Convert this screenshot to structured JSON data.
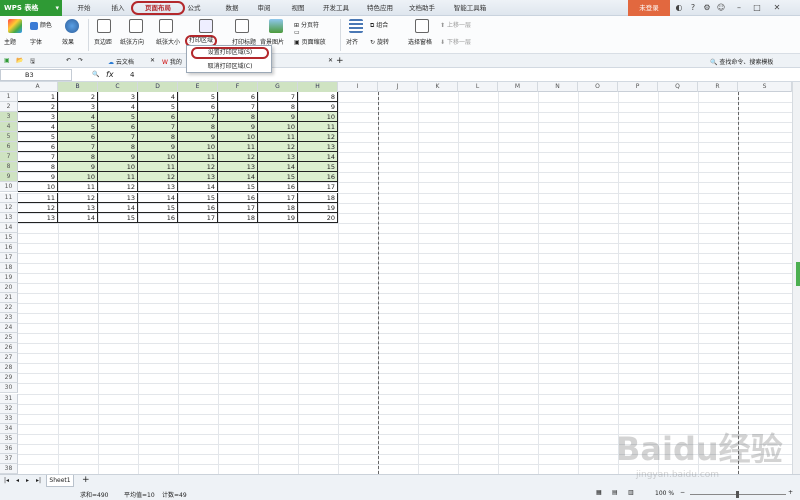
{
  "titlebar": {
    "app_name": "WPS 表格",
    "app_dd": "▾",
    "tabs": [
      "开始",
      "插入",
      "页面布局",
      "公式",
      "数据",
      "审阅",
      "视图",
      "开发工具",
      "特色应用",
      "文档助手",
      "智能工具箱"
    ],
    "login": "未登录"
  },
  "ribbon": {
    "theme": "主题",
    "color": "颜色",
    "font": "字体",
    "effect": "效果",
    "margin": "页边距",
    "orientation": "纸张方向",
    "size": "纸张大小",
    "print_area": "打印区域",
    "print_title": "打印标题",
    "background": "背景图片",
    "page_break": "分页符",
    "page_zoom": "页面缩放",
    "align": "对齐",
    "group": "组合",
    "rotate": "旋转",
    "select_pane": "选择窗格",
    "up_layer": "上移一层",
    "down_layer": "下移一层"
  },
  "dropdown": {
    "set": "设置打印区域(S)",
    "cancel": "取消打印区域(C)"
  },
  "docbar": {
    "cloud": "云文档",
    "mine": "我的",
    "search": "查找命令、搜索模板"
  },
  "formula": {
    "cell_ref": "B3",
    "fx": "fx",
    "value": "4"
  },
  "columns": [
    "A",
    "B",
    "C",
    "D",
    "E",
    "F",
    "G",
    "H",
    "I",
    "J",
    "K",
    "L",
    "M",
    "N",
    "O",
    "P",
    "Q",
    "R",
    "S"
  ],
  "rows": [
    [
      1,
      2,
      3,
      4,
      5,
      6,
      7,
      8
    ],
    [
      2,
      3,
      4,
      5,
      6,
      7,
      8,
      9
    ],
    [
      3,
      4,
      5,
      6,
      7,
      8,
      9,
      10
    ],
    [
      4,
      5,
      6,
      7,
      8,
      9,
      10,
      11
    ],
    [
      5,
      6,
      7,
      8,
      9,
      10,
      11,
      12
    ],
    [
      6,
      7,
      8,
      9,
      10,
      11,
      12,
      13
    ],
    [
      7,
      8,
      9,
      10,
      11,
      12,
      13,
      14
    ],
    [
      8,
      9,
      10,
      11,
      12,
      13,
      14,
      15
    ],
    [
      9,
      10,
      11,
      12,
      13,
      14,
      15,
      16
    ],
    [
      10,
      11,
      12,
      13,
      14,
      15,
      16,
      17
    ],
    [
      11,
      12,
      13,
      14,
      15,
      16,
      17,
      18
    ],
    [
      12,
      13,
      14,
      15,
      16,
      17,
      18,
      19
    ],
    [
      13,
      14,
      15,
      16,
      17,
      18,
      19,
      20
    ]
  ],
  "row_count": 38,
  "status": {
    "sheet": "Sheet1",
    "sum": "求和=490",
    "avg": "平均值=10",
    "count": "计数=49",
    "zoom": "100 %"
  },
  "watermark": {
    "text": "Baidu经验",
    "sub": "jingyan.baidu.com"
  }
}
